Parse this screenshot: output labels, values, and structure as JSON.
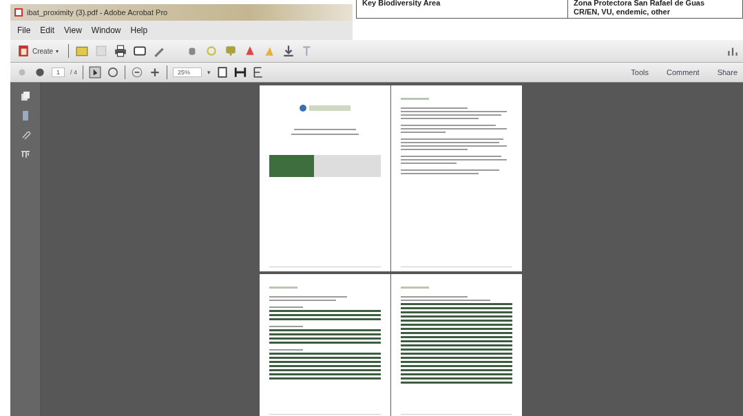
{
  "background_document": {
    "row": {
      "label": "Key Biodiversity Area",
      "value_lines": [
        "Zona Protectora San Rafael de Guas",
        "CR/EN, VU, endemic, other"
      ]
    }
  },
  "window": {
    "title": "ibat_proximity (3).pdf - Adobe Acrobat Pro"
  },
  "menu": [
    "File",
    "Edit",
    "View",
    "Window",
    "Help"
  ],
  "toolbar": {
    "create_label": "Create",
    "create_caret": "▾"
  },
  "navigation": {
    "page_value": "1",
    "page_count": "/ 4",
    "zoom_value": "25%",
    "zoom_caret": "▾"
  },
  "right_tabs": [
    "Tools",
    "Comment",
    "Share"
  ],
  "pages": [
    {
      "kind": "cover"
    },
    {
      "kind": "text"
    },
    {
      "kind": "tables"
    },
    {
      "kind": "list"
    }
  ]
}
